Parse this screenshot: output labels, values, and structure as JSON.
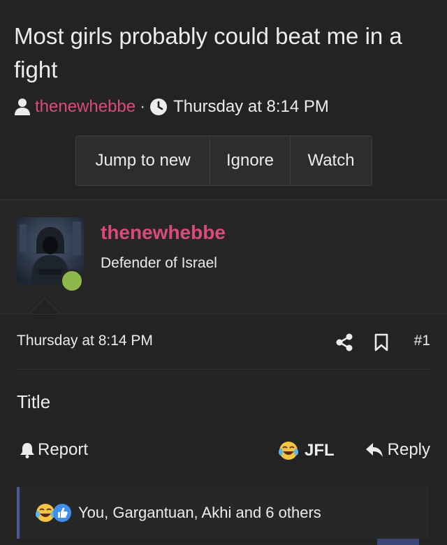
{
  "thread": {
    "title": "Most girls probably could beat me in a fight",
    "author": "thenewhebbe",
    "separator": "·",
    "date": "Thursday at 8:14 PM"
  },
  "actions": [
    {
      "label": "Jump to new"
    },
    {
      "label": "Ignore"
    },
    {
      "label": "Watch"
    }
  ],
  "user": {
    "name": "thenewhebbe",
    "title": "Defender of Israel",
    "status_color": "#8db94a"
  },
  "post": {
    "date": "Thursday at 8:14 PM",
    "number": "#1",
    "body": "Title",
    "report_label": "Report",
    "reaction_label": "JFL",
    "reply_label": "Reply"
  },
  "reactions": {
    "text": "You, Gargantuan, Akhi and 6 others",
    "icons": [
      "laughing-crying-icon",
      "thumbs-up-icon"
    ]
  },
  "colors": {
    "background": "#232323",
    "accent_pink": "#d94b78",
    "reaction_bar_accent": "#4a5a9c"
  }
}
